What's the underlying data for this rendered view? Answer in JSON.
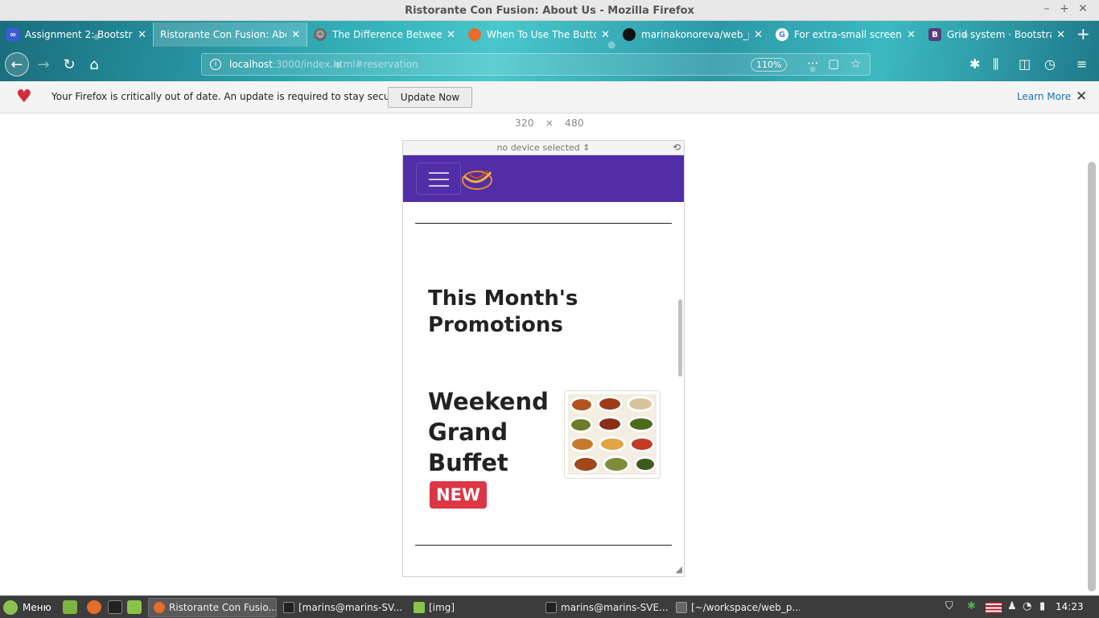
{
  "window": {
    "title": "Ristorante Con Fusion: About Us - Mozilla Firefox"
  },
  "tabs": [
    {
      "label": "Assignment 2: Bootstra",
      "icon": "assignment-icon"
    },
    {
      "label": "Ristorante Con Fusion: Abo",
      "icon": "page-icon",
      "active": true
    },
    {
      "label": "The Difference Betwee",
      "icon": "article-icon"
    },
    {
      "label": "When To Use The Butto",
      "icon": "firefox-icon"
    },
    {
      "label": "marinakonoreva/web_p",
      "icon": "github-icon"
    },
    {
      "label": "For extra-small screen",
      "icon": "google-icon"
    },
    {
      "label": "Grid system · Bootstrap",
      "icon": "bootstrap-icon"
    }
  ],
  "address_bar": {
    "host": "localhost",
    "path": ":3000/index.html#reservation",
    "zoom": "110%"
  },
  "notification": {
    "message": "Your Firefox is critically out of date. An update is required to stay secure.",
    "update_button": "Update Now",
    "learn_more": "Learn More"
  },
  "rdm": {
    "width": "320",
    "times": "×",
    "height": "480",
    "device": "no device selected"
  },
  "page": {
    "section_title": "This Month's Promotions",
    "promo_title": "Weekend Grand Buffet",
    "badge": "NEW"
  },
  "colors": {
    "navbar": "#512da8",
    "badge": "#dc3545"
  },
  "taskbar": {
    "menu_label": "Меню",
    "windows": [
      {
        "label": "Ristorante Con Fusio...",
        "active": true
      },
      {
        "label": "[marins@marins-SV..."
      },
      {
        "label": "[img]"
      },
      {
        "label": "marins@marins-SVE..."
      },
      {
        "label": "[~/workspace/web_p..."
      }
    ],
    "clock": "14:23"
  }
}
